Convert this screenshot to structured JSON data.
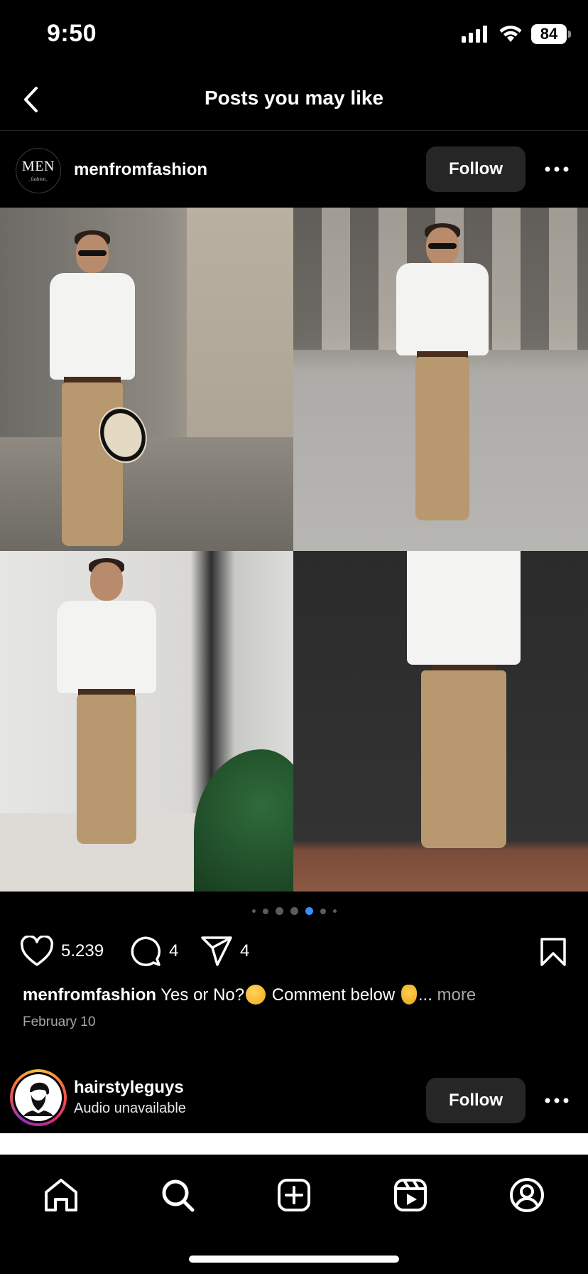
{
  "status_bar": {
    "time": "9:50",
    "battery": "84"
  },
  "header": {
    "title": "Posts you may like"
  },
  "post1": {
    "avatar_logo": "MEN",
    "avatar_logo_sub": "_fashion_",
    "username": "menfromfashion",
    "follow_label": "Follow",
    "likes": "5.239",
    "comments": "4",
    "shares": "4",
    "caption_user": "menfromfashion",
    "caption_text_1": " Yes or No?",
    "caption_text_2": " Comment below ",
    "caption_ellipsis": "... ",
    "caption_more": "more",
    "date": "February 10",
    "carousel_total": 7,
    "carousel_active": 5
  },
  "post2": {
    "username": "hairstyleguys",
    "audio_status": "Audio unavailable",
    "follow_label": "Follow"
  },
  "tabs": [
    "home-icon",
    "search-icon",
    "create-icon",
    "reels-icon",
    "profile-icon"
  ],
  "colors": {
    "background": "#000000",
    "button": "#262626",
    "accent": "#3b8df7",
    "muted": "#a8a8a8"
  }
}
